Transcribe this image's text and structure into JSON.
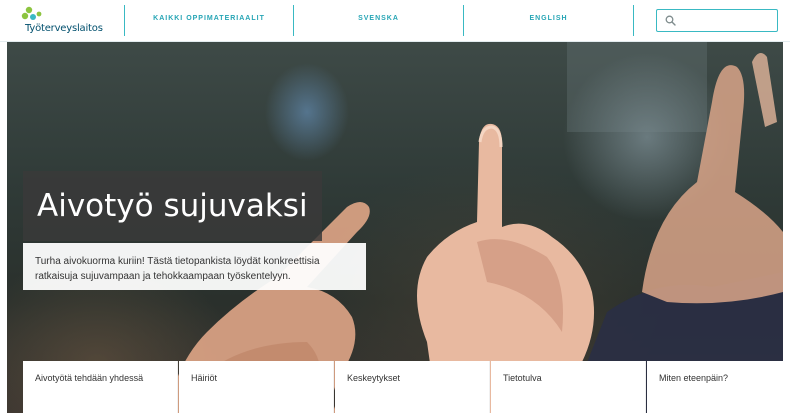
{
  "header": {
    "logo_text": "Työterveyslaitos",
    "nav": [
      {
        "label": "Kaikki oppimateriaalit"
      },
      {
        "label": "Svenska"
      },
      {
        "label": "English"
      }
    ],
    "search": {
      "placeholder": "",
      "value": ""
    }
  },
  "hero": {
    "title": "Aivotyö sujuvaksi",
    "description": "Turha aivokuorma kuriin! Tästä tietopankista löydät konkreettisia ratkaisuja sujuvampaan ja tehokkaampaan työskentelyyn."
  },
  "tabs": [
    {
      "label": "Aivotyötä tehdään yhdessä"
    },
    {
      "label": "Häiriöt"
    },
    {
      "label": "Keskeytykset"
    },
    {
      "label": "Tietotulva"
    },
    {
      "label": "Miten eteenpäin?"
    }
  ],
  "colors": {
    "brand_teal": "#26a5b5",
    "brand_dark": "#004f6d",
    "logo_green": "#8cc43f"
  }
}
